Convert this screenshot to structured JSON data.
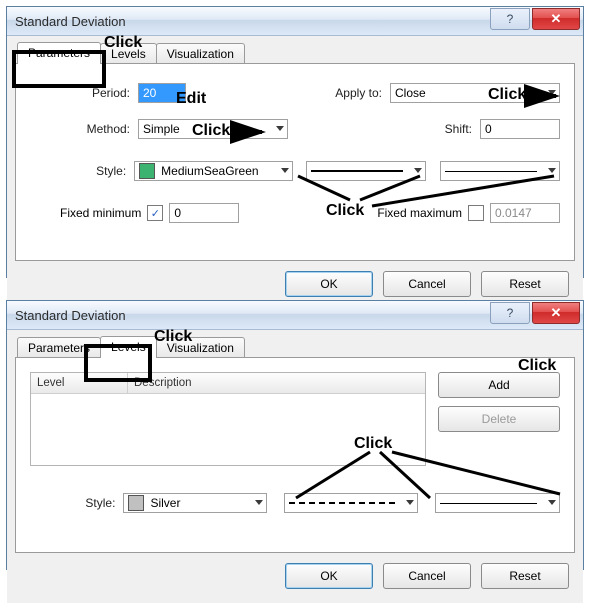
{
  "dialog1": {
    "title": "Standard Deviation",
    "tabs": {
      "parameters": "Parameters",
      "levels": "Levels",
      "visualization": "Visualization"
    },
    "period_label": "Period:",
    "period_value": "20",
    "apply_label": "Apply to:",
    "apply_value": "Close",
    "method_label": "Method:",
    "method_value": "Simple",
    "shift_label": "Shift:",
    "shift_value": "0",
    "style_label": "Style:",
    "style_color_name": "MediumSeaGreen",
    "style_color_hex": "#3CB371",
    "fixedmin_label": "Fixed minimum",
    "fixedmin_checked": "✓",
    "fixedmin_value": "0",
    "fixedmax_label": "Fixed maximum",
    "fixedmax_value": "0.0147",
    "ok": "OK",
    "cancel": "Cancel",
    "reset": "Reset"
  },
  "dialog2": {
    "title": "Standard Deviation",
    "tabs": {
      "parameters": "Parameters",
      "levels": "Levels",
      "visualization": "Visualization"
    },
    "list": {
      "col_level": "Level",
      "col_desc": "Description"
    },
    "add": "Add",
    "delete": "Delete",
    "style_label": "Style:",
    "style_color_name": "Silver",
    "style_color_hex": "#C0C0C0",
    "ok": "OK",
    "cancel": "Cancel",
    "reset": "Reset"
  },
  "annotations": {
    "click": "Click",
    "edit": "Edit"
  }
}
